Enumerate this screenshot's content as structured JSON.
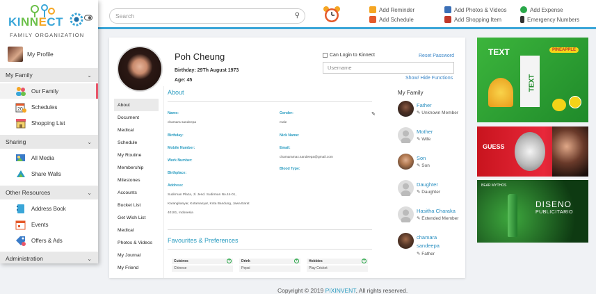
{
  "brand": {
    "logo_text": "KINNECT",
    "tagline": "FAMILY ORGANIZATION"
  },
  "sidebar": {
    "profile_label": "My Profile",
    "sections": [
      {
        "title": "My Family",
        "items": [
          {
            "label": "Our Family",
            "icon": "family-icon",
            "active": true
          },
          {
            "label": "Schedules",
            "icon": "calendar-icon"
          },
          {
            "label": "Shopping List",
            "icon": "store-icon"
          }
        ]
      },
      {
        "title": "Sharing",
        "items": [
          {
            "label": "All Media",
            "icon": "media-icon"
          },
          {
            "label": "Share Walls",
            "icon": "share-icon"
          }
        ]
      },
      {
        "title": "Other Resources",
        "items": [
          {
            "label": "Address Book",
            "icon": "address-book-icon"
          },
          {
            "label": "Events",
            "icon": "events-icon"
          },
          {
            "label": "Offers & Ads",
            "icon": "offers-icon"
          }
        ]
      },
      {
        "title": "Administration",
        "items": []
      }
    ]
  },
  "topbar": {
    "search_placeholder": "Search",
    "links": [
      {
        "label": "Add Reminder",
        "icon": "reminder-icon",
        "color": "#f5a623"
      },
      {
        "label": "Add Schedule",
        "icon": "schedule-icon",
        "color": "#e55a2b"
      },
      {
        "label": "Add Photos & Videos",
        "icon": "photos-icon",
        "color": "#3b6fb6"
      },
      {
        "label": "Add Shopping Item",
        "icon": "shopping-icon",
        "color": "#c0392b"
      },
      {
        "label": "Add Expense",
        "icon": "expense-icon",
        "color": "#2aa84a"
      },
      {
        "label": "Emergency Numbers",
        "icon": "phone-icon",
        "color": "#333333"
      }
    ]
  },
  "profile": {
    "name": "Poh Cheung",
    "birthday": "Birthday: 29Th August 1973",
    "age": "Age: 45",
    "login_label": "Can Login to Kinnect",
    "reset_label": "Reset Password",
    "username_placeholder": "Username",
    "show_hide": "Show/ Hide Functions"
  },
  "tabs": [
    "About",
    "Document",
    "Medical",
    "Schedule",
    "My Routine",
    "Membership",
    "Milestones",
    "Accounts",
    "Bucket List",
    "Get Wish List",
    "Medical",
    "Photos & Videos",
    "My Journal",
    "My Friend"
  ],
  "about": {
    "title": "About",
    "name_label": "Name:",
    "name_value": "chamara sandeepa",
    "gender_label": "Gender:",
    "gender_value": "male",
    "birthday_label": "Birthday:",
    "nick_label": "Nick Name:",
    "mobile_label": "Mobile Number:",
    "email_label": "Email:",
    "email_value": "chamaramax.sandeepa@gmail.com",
    "work_label": "Work Number:",
    "blood_label": "Blood Type:",
    "birthplace_label": "Birthplace:",
    "address_label": "Address:",
    "address_line1": "Sudirman Plaza, Jl. Jend. Sudirman No.44-01,",
    "address_line2": "Karangkanyar, Kotamanyar, Kota Bandung, Jawa Barat",
    "address_line3": "40181, Indonesia"
  },
  "favourites": {
    "title": "Favourites & Preferences",
    "items": [
      {
        "head": "Cuisines",
        "value": "Chinese"
      },
      {
        "head": "Drink",
        "value": "Pepsi"
      },
      {
        "head": "Hobbies",
        "value": "Play Cricket"
      }
    ]
  },
  "family": {
    "title": "My Family",
    "members": [
      {
        "name": "Father",
        "relation": "Unknown Member",
        "photo": true
      },
      {
        "name": "Mother",
        "relation": "Wife",
        "photo": false
      },
      {
        "name": "Son",
        "relation": "Son",
        "photo": true
      },
      {
        "name": "Daughter",
        "relation": "Daughter",
        "photo": false
      },
      {
        "name": "Hasitha Charaka",
        "relation": "Extended Member",
        "photo": false
      },
      {
        "name": "chamara",
        "name2": "sandeepa",
        "relation": "Father",
        "photo": true
      }
    ]
  },
  "ads": {
    "ad1_text1": "TEXT",
    "ad1_text2": "TEXT",
    "ad1_badge": "PINEAPPLE",
    "ad2_brand": "GUESS",
    "ad3_brand": "BEAR MYTHOS",
    "ad3_title": "DISENO",
    "ad3_sub": "PUBLICITARIO"
  },
  "footer": {
    "prefix": "Copyright © 2019 ",
    "link": "PIXINVENT",
    "suffix": ", All rights reserved."
  }
}
